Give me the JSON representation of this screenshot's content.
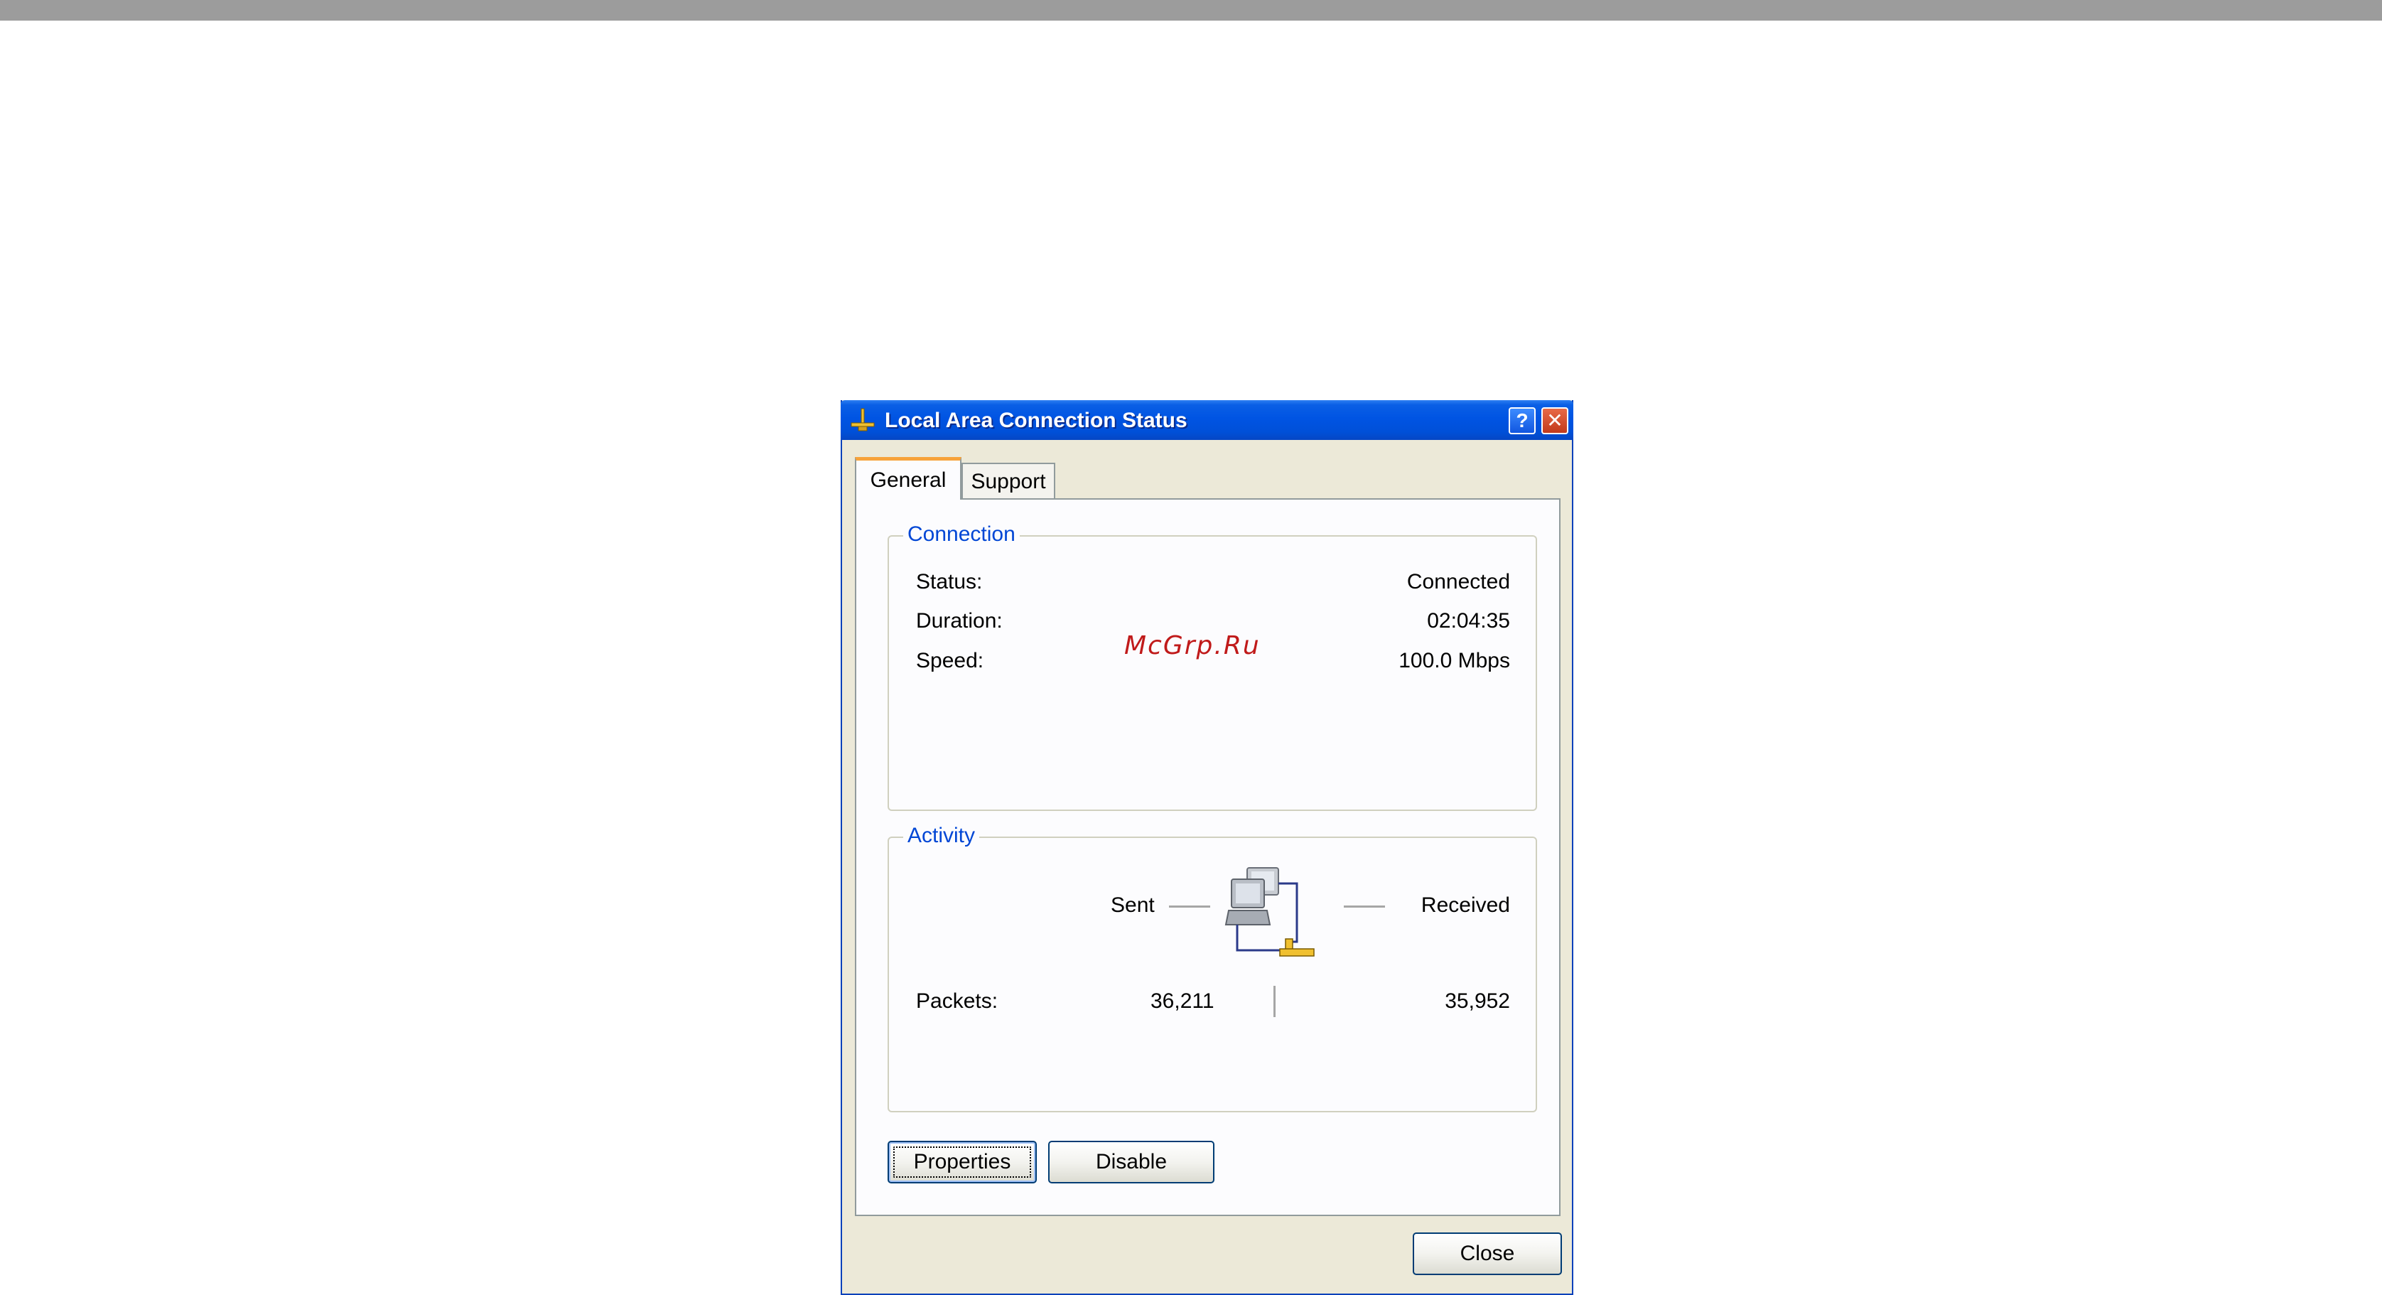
{
  "watermark": "McGrp.Ru",
  "window": {
    "title": "Local Area Connection Status",
    "title_icon": "network-connection-icon",
    "help_button": "?",
    "close_glyph": "✕"
  },
  "tabs": [
    {
      "label": "General",
      "selected": true
    },
    {
      "label": "Support",
      "selected": false
    }
  ],
  "connection": {
    "legend": "Connection",
    "rows": [
      {
        "label": "Status:",
        "value": "Connected"
      },
      {
        "label": "Duration:",
        "value": "02:04:35"
      },
      {
        "label": "Speed:",
        "value": "100.0 Mbps"
      }
    ]
  },
  "activity": {
    "legend": "Activity",
    "sent_label": "Sent",
    "received_label": "Received",
    "packets_label": "Packets:",
    "packets_sent": "36,211",
    "packets_received": "35,952",
    "icon": "network-computers-icon"
  },
  "buttons": {
    "properties": "Properties",
    "disable": "Disable",
    "close": "Close"
  },
  "colors": {
    "titlebar": "#0054e3",
    "window_bg": "#ece9d8",
    "groupbox_legend": "#0046d5",
    "tab_highlight": "#f7a23a",
    "watermark": "#c01a1a"
  }
}
